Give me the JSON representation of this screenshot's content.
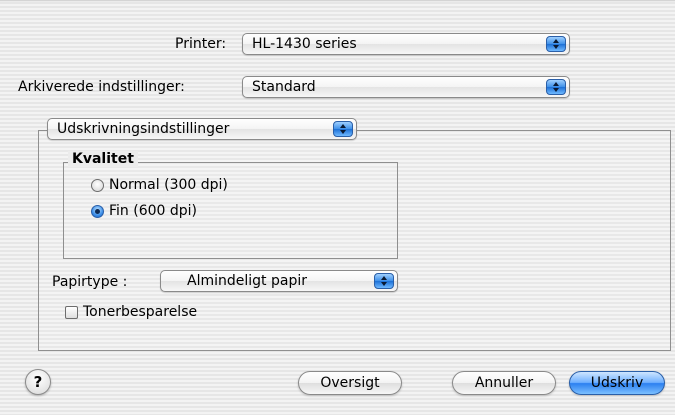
{
  "printer": {
    "label": "Printer:",
    "value": "HL-1430 series"
  },
  "presets": {
    "label": "Arkiverede indstillinger:",
    "value": "Standard"
  },
  "panel_menu": {
    "value": "Udskrivningsindstillinger"
  },
  "quality": {
    "legend": "Kvalitet",
    "options": [
      {
        "label": "Normal (300 dpi)",
        "checked": false
      },
      {
        "label": "Fin (600 dpi)",
        "checked": true
      }
    ]
  },
  "paper_type": {
    "label": "Papirtype :",
    "value": "Almindeligt papir"
  },
  "toner_save": {
    "label": "Tonerbesparelse",
    "checked": false
  },
  "buttons": {
    "help": "?",
    "preview": "Oversigt",
    "cancel": "Annuller",
    "print": "Udskriv"
  },
  "colors": {
    "aqua_blue": "#3d8fe8",
    "background": "#ececec"
  },
  "icons": {
    "popup_arrows": "up-down-arrows-icon",
    "help": "help-icon"
  }
}
